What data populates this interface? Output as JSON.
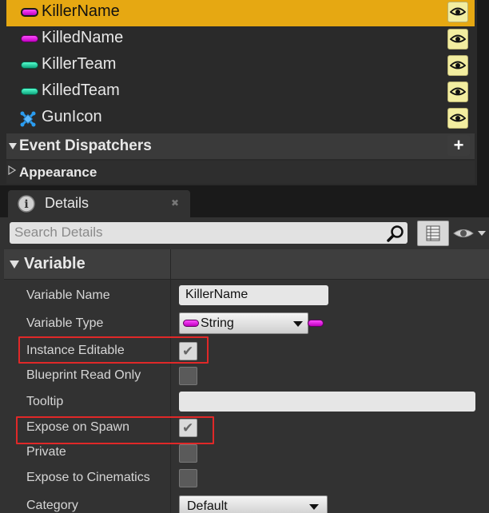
{
  "variables": [
    {
      "name": "KillerName",
      "pin": "magenta",
      "selected": true
    },
    {
      "name": "KilledName",
      "pin": "magenta",
      "selected": false
    },
    {
      "name": "KillerTeam",
      "pin": "teal",
      "selected": false
    },
    {
      "name": "KilledTeam",
      "pin": "teal",
      "selected": false
    },
    {
      "name": "GunIcon",
      "pin": "object",
      "selected": false
    }
  ],
  "sections": {
    "event_dispatchers": "Event Dispatchers",
    "appearance": "Appearance"
  },
  "details_tab": {
    "label": "Details",
    "search_placeholder": "Search Details"
  },
  "variable_section": {
    "title": "Variable",
    "rows": {
      "variable_name": {
        "label": "Variable Name",
        "value": "KillerName"
      },
      "variable_type": {
        "label": "Variable Type",
        "value": "String"
      },
      "instance_editable": {
        "label": "Instance Editable",
        "checked": true
      },
      "blueprint_read_only": {
        "label": "Blueprint Read Only",
        "checked": false
      },
      "tooltip": {
        "label": "Tooltip",
        "value": ""
      },
      "expose_on_spawn": {
        "label": "Expose on Spawn",
        "checked": true
      },
      "private": {
        "label": "Private",
        "checked": false
      },
      "expose_to_cinematics": {
        "label": "Expose to Cinematics",
        "checked": false
      },
      "category": {
        "label": "Category",
        "value": "Default"
      }
    }
  },
  "colors": {
    "selection": "#e6a812",
    "string_pin": "#e03ce0",
    "struct_pin": "#1fd3a0",
    "highlight": "#e02828"
  }
}
